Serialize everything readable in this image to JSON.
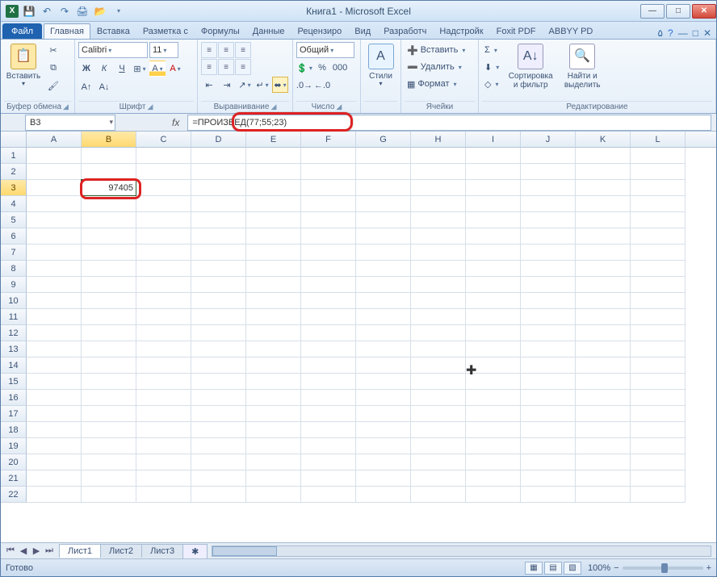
{
  "title": "Книга1  -  Microsoft Excel",
  "qat_excel_letter": "X",
  "tabs": {
    "file": "Файл",
    "items": [
      "Главная",
      "Вставка",
      "Разметка с",
      "Формулы",
      "Данные",
      "Рецензиро",
      "Вид",
      "Разработч",
      "Надстройк",
      "Foxit PDF",
      "ABBYY PD"
    ],
    "active_index": 0
  },
  "ribbon": {
    "clipboard": {
      "paste": "Вставить",
      "label": "Буфер обмена"
    },
    "font": {
      "name": "Calibri",
      "size": "11",
      "label": "Шрифт"
    },
    "alignment": {
      "label": "Выравнивание"
    },
    "number": {
      "format": "Общий",
      "label": "Число"
    },
    "styles": {
      "btn": "Стили",
      "label": ""
    },
    "cells": {
      "insert": "Вставить",
      "delete": "Удалить",
      "format": "Формат",
      "label": "Ячейки"
    },
    "editing": {
      "sort": "Сортировка\nи фильтр",
      "find": "Найти и\nвыделить",
      "label": "Редактирование"
    }
  },
  "formula_bar": {
    "name_box": "B3",
    "fx": "fx",
    "formula": "=ПРОИЗВЕД(77;55;23)"
  },
  "grid": {
    "columns": [
      "A",
      "B",
      "C",
      "D",
      "E",
      "F",
      "G",
      "H",
      "I",
      "J",
      "K",
      "L"
    ],
    "row_count": 22,
    "active_cell": {
      "row": 3,
      "col": "B",
      "value": "97405"
    }
  },
  "sheets": {
    "tabs": [
      "Лист1",
      "Лист2",
      "Лист3"
    ],
    "active": 0
  },
  "status": {
    "ready": "Готово",
    "zoom": "100%"
  }
}
